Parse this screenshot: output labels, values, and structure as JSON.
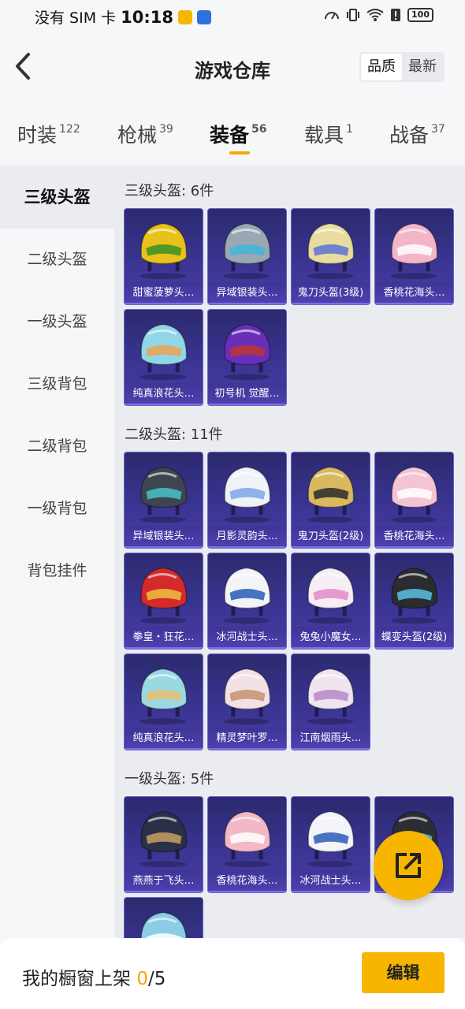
{
  "status_bar": {
    "carrier": "没有 SIM 卡",
    "time": "10:18",
    "battery": "100"
  },
  "header": {
    "title": "游戏仓库",
    "sort_options": [
      "品质",
      "最新"
    ],
    "sort_active": "品质"
  },
  "tabs": [
    {
      "label": "时装",
      "count": "122"
    },
    {
      "label": "枪械",
      "count": "39"
    },
    {
      "label": "装备",
      "count": "56"
    },
    {
      "label": "载具",
      "count": "1"
    },
    {
      "label": "战备",
      "count": "37"
    }
  ],
  "active_tab": "装备",
  "sidebar": {
    "items": [
      "三级头盔",
      "二级头盔",
      "一级头盔",
      "三级背包",
      "二级背包",
      "一级背包",
      "背包挂件"
    ],
    "active": "三级头盔"
  },
  "sections": [
    {
      "title": "三级头盔: 6件",
      "items": [
        {
          "name": "甜蜜菠萝头…",
          "color": "#e8c21a",
          "accent": "#3a8f2a"
        },
        {
          "name": "异域银装头…",
          "color": "#9aa8b4",
          "accent": "#3fb6d8"
        },
        {
          "name": "鬼刀头盔(3级)",
          "color": "#e8dca0",
          "accent": "#5a72d6"
        },
        {
          "name": "香桃花海头…",
          "color": "#f2b6c8",
          "accent": "#ffffff"
        },
        {
          "name": "纯真浪花头…",
          "color": "#8fd6e6",
          "accent": "#f0a24a"
        },
        {
          "name": "初号机 觉醒…",
          "color": "#6a2fb8",
          "accent": "#c0342c"
        }
      ]
    },
    {
      "title": "二级头盔: 11件",
      "items": [
        {
          "name": "异域银装头…",
          "color": "#3d4650",
          "accent": "#49c2c8"
        },
        {
          "name": "月影灵韵头…",
          "color": "#f0f2f8",
          "accent": "#7fa6e8"
        },
        {
          "name": "鬼刀头盔(2级)",
          "color": "#d9b860",
          "accent": "#2a2a2a"
        },
        {
          "name": "香桃花海头…",
          "color": "#f4c4d2",
          "accent": "#ffffff"
        },
        {
          "name": "拳皇・狂花…",
          "color": "#d42a2a",
          "accent": "#f0c040"
        },
        {
          "name": "冰河战士头…",
          "color": "#f2f4f8",
          "accent": "#2a5ab8"
        },
        {
          "name": "兔兔小魔女…",
          "color": "#f6eef4",
          "accent": "#e08ac8"
        },
        {
          "name": "蝶变头盔(2级)",
          "color": "#2a2c30",
          "accent": "#5ac0e0"
        },
        {
          "name": "纯真浪花头…",
          "color": "#9ad8e2",
          "accent": "#e8c070"
        },
        {
          "name": "精灵梦叶罗…",
          "color": "#f2e2e6",
          "accent": "#c89070"
        },
        {
          "name": "江南烟雨头…",
          "color": "#f0e4ee",
          "accent": "#b888c8"
        }
      ]
    },
    {
      "title": "一级头盔: 5件",
      "items": [
        {
          "name": "燕燕于飞头…",
          "color": "#2a3048",
          "accent": "#c8a060"
        },
        {
          "name": "香桃花海头…",
          "color": "#f2b8c6",
          "accent": "#ffffff"
        },
        {
          "name": "冰河战士头…",
          "color": "#f2f4f8",
          "accent": "#2a5ab8"
        },
        {
          "name": ")",
          "color": "#2c2e34",
          "accent": "#5ac0e0"
        },
        {
          "name": "",
          "color": "#8ccde6",
          "accent": "#ffffff"
        }
      ]
    }
  ],
  "bottom_bar": {
    "label": "我的橱窗上架",
    "current": "0",
    "total": "/5",
    "edit_label": "编辑"
  },
  "colors": {
    "accent": "#f5a600",
    "card_bg": "#3a3492"
  }
}
